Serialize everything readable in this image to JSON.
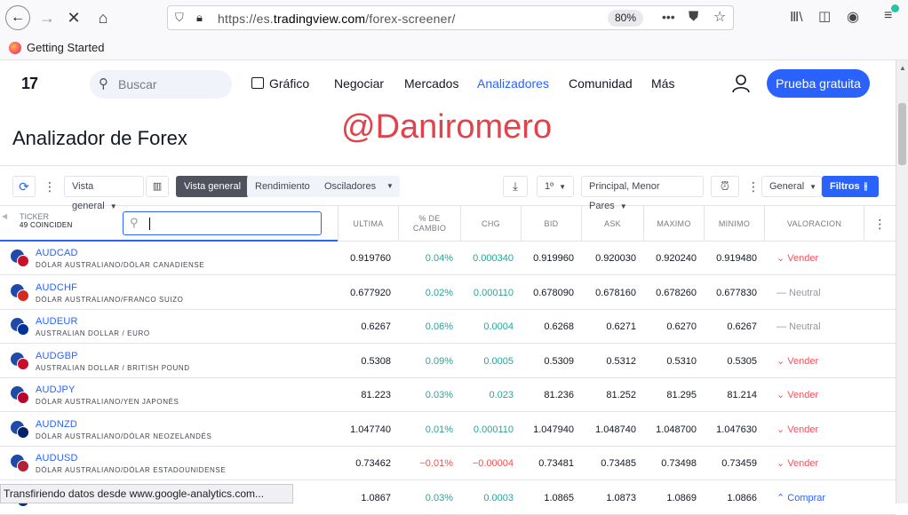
{
  "browser": {
    "url_prefix": "https://es.",
    "url_domain": "tradingview.com",
    "url_path": "/forex-screener/",
    "zoom": "80%",
    "bookmark": "Getting Started",
    "status_text": "Transfiriendo datos desde www.google-analytics.com..."
  },
  "header": {
    "logo": "17",
    "search_placeholder": "Buscar",
    "nav": [
      "Gráfico",
      "Negociar",
      "Mercados",
      "Analizadores",
      "Comunidad",
      "Más"
    ],
    "trial_button": "Prueba gratuita"
  },
  "page": {
    "title": "Analizador de Forex",
    "watermark": "@Daniromero"
  },
  "toolbar": {
    "view_select": "Vista general",
    "tabs": [
      "Vista general",
      "Rendimiento",
      "Osciladores"
    ],
    "interval": "1º",
    "list_select": "Principal, Menor Pares",
    "general_select": "General",
    "filters": "Filtros"
  },
  "table": {
    "ticker_header": "TICKER",
    "ticker_count": "49 COINCIDEN",
    "columns": [
      "ULTIMA",
      "% DE CAMBIO",
      "CHG",
      "BID",
      "ASK",
      "MAXIMO",
      "MINIMO",
      "VALORACION"
    ],
    "rows": [
      {
        "symbol": "AUDCAD",
        "desc": "DÓLAR AUSTRALIANO/DÓLAR CANADIENSE",
        "last": "0.919760",
        "pct": "0.04%",
        "chg": "0.000340",
        "bid": "0.919960",
        "ask": "0.920030",
        "high": "0.920240",
        "low": "0.919480",
        "rating": "⌄ Vender",
        "rating_type": "sell",
        "dir": "pos"
      },
      {
        "symbol": "AUDCHF",
        "desc": "DÓLAR AUSTRALIANO/FRANCO SUIZO",
        "last": "0.677920",
        "pct": "0.02%",
        "chg": "0.000110",
        "bid": "0.678090",
        "ask": "0.678160",
        "high": "0.678260",
        "low": "0.677830",
        "rating": "— Neutral",
        "rating_type": "neutral",
        "dir": "pos"
      },
      {
        "symbol": "AUDEUR",
        "desc": "AUSTRALIAN DOLLAR / EURO",
        "last": "0.6267",
        "pct": "0.06%",
        "chg": "0.0004",
        "bid": "0.6268",
        "ask": "0.6271",
        "high": "0.6270",
        "low": "0.6267",
        "rating": "— Neutral",
        "rating_type": "neutral",
        "dir": "pos"
      },
      {
        "symbol": "AUDGBP",
        "desc": "AUSTRALIAN DOLLAR / BRITISH POUND",
        "last": "0.5308",
        "pct": "0.09%",
        "chg": "0.0005",
        "bid": "0.5309",
        "ask": "0.5312",
        "high": "0.5310",
        "low": "0.5305",
        "rating": "⌄ Vender",
        "rating_type": "sell",
        "dir": "pos"
      },
      {
        "symbol": "AUDJPY",
        "desc": "DÓLAR AUSTRALIANO/YEN JAPONÉS",
        "last": "81.223",
        "pct": "0.03%",
        "chg": "0.023",
        "bid": "81.236",
        "ask": "81.252",
        "high": "81.295",
        "low": "81.214",
        "rating": "⌄ Vender",
        "rating_type": "sell",
        "dir": "pos"
      },
      {
        "symbol": "AUDNZD",
        "desc": "DÓLAR AUSTRALIANO/DÓLAR NEOZELANDÉS",
        "last": "1.047740",
        "pct": "0.01%",
        "chg": "0.000110",
        "bid": "1.047940",
        "ask": "1.048740",
        "high": "1.048700",
        "low": "1.047630",
        "rating": "⌄ Vender",
        "rating_type": "sell",
        "dir": "pos"
      },
      {
        "symbol": "AUDUSD",
        "desc": "DÓLAR AUSTRALIANO/DÓLAR ESTADOUNIDENSE",
        "last": "0.73462",
        "pct": "−0.01%",
        "chg": "−0.00004",
        "bid": "0.73481",
        "ask": "0.73485",
        "high": "0.73498",
        "low": "0.73459",
        "rating": "⌄ Vender",
        "rating_type": "sell",
        "dir": "neg"
      },
      {
        "symbol": "",
        "desc": "",
        "last": "1.0867",
        "pct": "0.03%",
        "chg": "0.0003",
        "bid": "1.0865",
        "ask": "1.0873",
        "high": "1.0869",
        "low": "1.0866",
        "rating": "⌃ Comprar",
        "rating_type": "buy",
        "dir": "pos"
      }
    ]
  },
  "colors": {
    "accent": "#2962ff",
    "positive": "#26a69a",
    "negative": "#ef5350",
    "sell": "#f7525f",
    "neutral": "#9598a1"
  }
}
